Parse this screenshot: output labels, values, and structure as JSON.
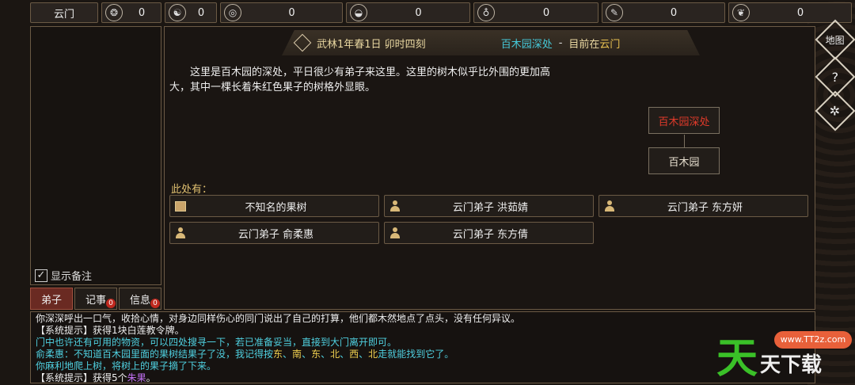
{
  "topbar": {
    "sect": "云门",
    "resources": [
      {
        "icon": "coin-pouch-icon",
        "glyph": "❂",
        "value": "0"
      },
      {
        "icon": "yin-yang-icon",
        "glyph": "☯",
        "value": "0"
      },
      {
        "icon": "copper-coin-icon",
        "glyph": "◎",
        "value": "0"
      },
      {
        "icon": "food-bowl-icon",
        "glyph": "◒",
        "value": "0"
      },
      {
        "icon": "potion-gourd-icon",
        "glyph": "♁",
        "value": "0"
      },
      {
        "icon": "scroll-icon",
        "glyph": "✎",
        "value": "0"
      },
      {
        "icon": "dragon-icon",
        "glyph": "❦",
        "value": "0"
      }
    ]
  },
  "left": {
    "show_notes": "显示备注",
    "tabs": [
      {
        "label": "弟子",
        "badge": ""
      },
      {
        "label": "记事",
        "badge": "0"
      },
      {
        "label": "信息",
        "badge": "0"
      }
    ]
  },
  "header": {
    "date": "武林1年春1日 卯时四刻",
    "location": "百木园深处",
    "separator": "-",
    "now": "目前在",
    "city": "云门"
  },
  "description": "这里是百木园的深处，平日很少有弟子来这里。这里的树木似乎比外围的更加高大，其中一棵长着朱红色果子的树格外显眼。",
  "minimap": {
    "current": "百木园深处",
    "neighbor": "百木园"
  },
  "here": {
    "title": "此处有：",
    "entities": [
      {
        "name": "不知名的果树",
        "kind": "object"
      },
      {
        "name": "云门弟子 洪茹婧",
        "kind": "person"
      },
      {
        "name": "云门弟子 东方妍",
        "kind": "person"
      },
      {
        "name": "云门弟子 俞柔惠",
        "kind": "person"
      },
      {
        "name": "云门弟子 东方倩",
        "kind": "person"
      }
    ]
  },
  "right_icons": [
    {
      "name": "map-icon",
      "glyph": "地图"
    },
    {
      "name": "help-icon",
      "glyph": "?"
    },
    {
      "name": "settings-gear-icon",
      "glyph": "✲"
    }
  ],
  "log": {
    "line1": "你深深呼出一口气，收拾心情，对身边同样伤心的同门说出了自己的打算，他们都木然地点了点头，没有任何异议。",
    "line2": "【系统提示】获得1块白莲教令牌。",
    "line3": "门中也许还有可用的物资，可以四处搜寻一下，若已准备妥当，直接到大门离开即可。",
    "line4a": "俞柔惠：不知道百木园里面的果树结果子了没，我记得按",
    "line4_dirs": [
      "东",
      "南",
      "东",
      "北",
      "西",
      "北"
    ],
    "line4_sep": "、",
    "line4b": "走就能找到它了。",
    "line5": "你麻利地爬上树，将树上的果子摘了下来。",
    "line6a": "【系统提示】获得5个",
    "line6_item": "朱果",
    "line6_end": "。"
  },
  "watermark": {
    "big": "天",
    "small": "天下载",
    "url": "www.TT2z.com"
  },
  "colors": {
    "accent_cyan": "#4fd0e0",
    "accent_yellow": "#f0d050",
    "accent_purple": "#c070f0",
    "red": "#e03a2a"
  }
}
